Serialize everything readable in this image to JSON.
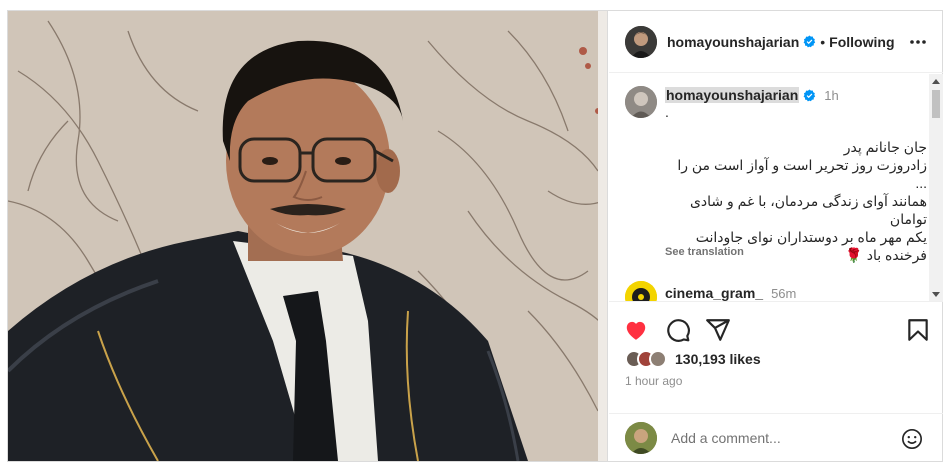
{
  "post": {
    "author": "homayounshajarian",
    "follow_status": "Following",
    "separator": "•"
  },
  "caption": {
    "username": "homayounshajarian",
    "time": "1h",
    "dot": ".",
    "text": "جان جانانم پدر\nزادروزت روز تحریر است و آواز است من را ...\nهمانند آوای زندگی مردمان، با غم و شادی توامان\nیکم مهر ماه بر دوستداران نوای جاودانت\nفرخنده باد 🌹",
    "see_translation": "See translation"
  },
  "comments": [
    {
      "username": "cinema_gram_",
      "time": "56m"
    }
  ],
  "stats": {
    "likes": "130,193 likes",
    "posted": "1 hour ago"
  },
  "add_comment": {
    "placeholder": "Add a comment..."
  },
  "icons": {
    "like": "heart-filled-icon",
    "comment": "comment-bubble-icon",
    "share": "paper-plane-icon",
    "save": "bookmark-icon",
    "more": "more-horizontal-icon",
    "emoji": "emoji-smile-icon",
    "verified": "verified-badge-icon"
  },
  "colors": {
    "like_red": "#ff3040",
    "verified_blue": "#0095f6",
    "muted_text": "#8e8e8e"
  }
}
